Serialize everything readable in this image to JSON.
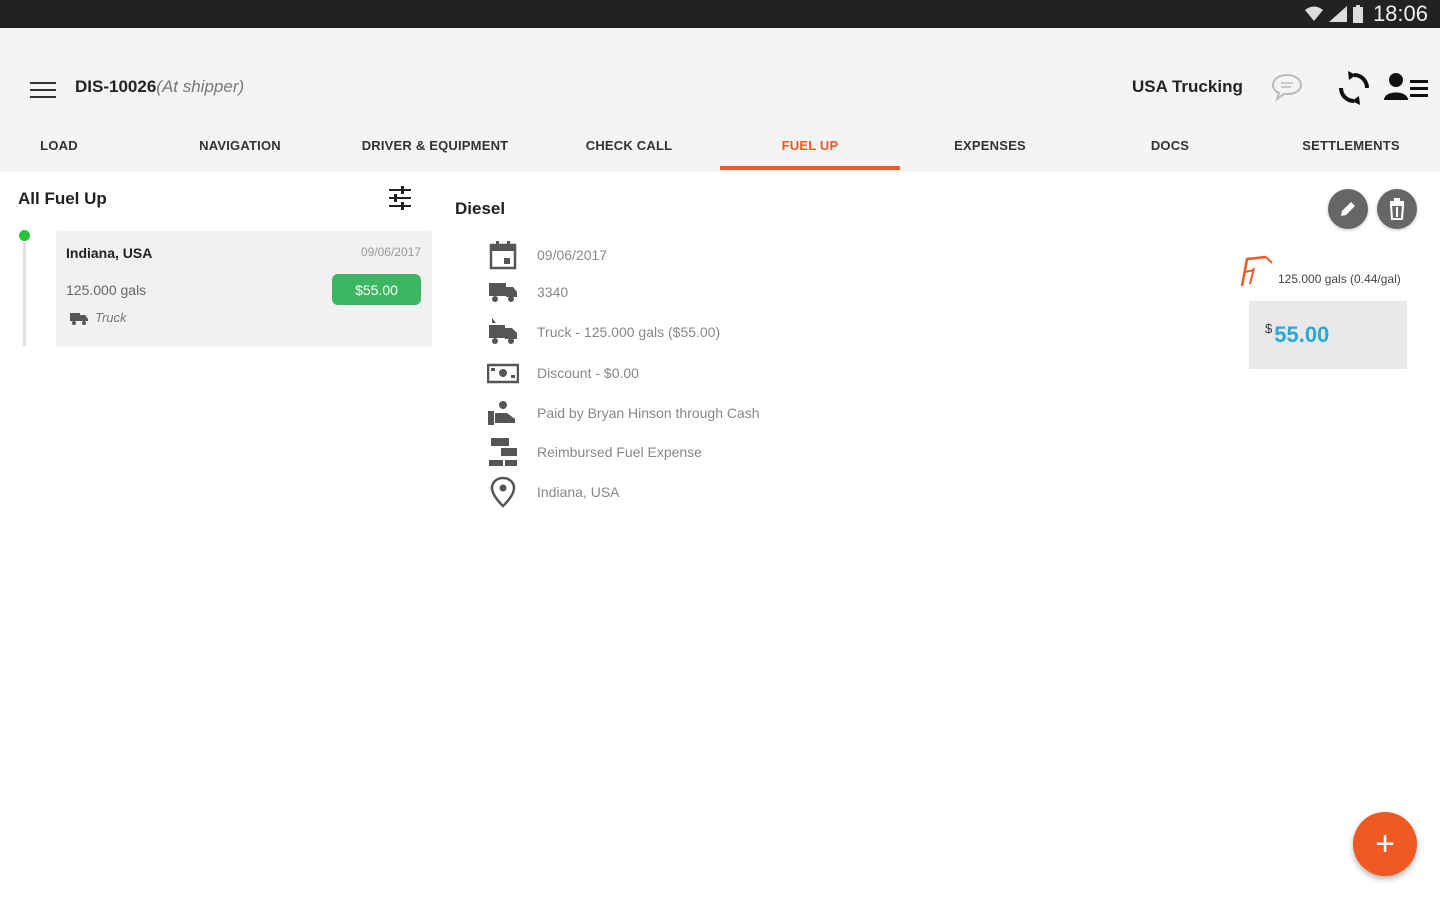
{
  "status_bar": {
    "time": "18:06"
  },
  "header": {
    "load_id": "DIS-10026",
    "load_status": "(At shipper)",
    "company": "USA Trucking"
  },
  "tabs": [
    {
      "label": "LOAD"
    },
    {
      "label": "NAVIGATION"
    },
    {
      "label": "DRIVER & EQUIPMENT"
    },
    {
      "label": "CHECK CALL"
    },
    {
      "label": "FUEL UP",
      "active": true
    },
    {
      "label": "EXPENSES"
    },
    {
      "label": "DOCS"
    },
    {
      "label": "SETTLEMENTS"
    }
  ],
  "list": {
    "title": "All Fuel Up",
    "items": [
      {
        "location": "Indiana, USA",
        "date": "09/06/2017",
        "gallons": "125.000 gals",
        "amount": "$55.00",
        "vehicle": "Truck"
      }
    ]
  },
  "detail": {
    "title": "Diesel",
    "rows": [
      {
        "icon": "calendar-icon",
        "text": "09/06/2017"
      },
      {
        "icon": "truck-icon",
        "text": "3340"
      },
      {
        "icon": "fuel-truck-icon",
        "text": "Truck - 125.000 gals ($55.00)"
      },
      {
        "icon": "discount-icon",
        "text": "Discount - $0.00"
      },
      {
        "icon": "payment-icon",
        "text": "Paid by Bryan Hinson through Cash"
      },
      {
        "icon": "reimburse-icon",
        "text": "Reimbursed Fuel Expense"
      },
      {
        "icon": "location-pin-icon",
        "text": "Indiana, USA"
      }
    ],
    "summary": "125.000 gals (0.44/gal)",
    "total_currency": "$",
    "total_amount": "55.00"
  },
  "fab_label": "+",
  "colors": {
    "accent": "#f05a22",
    "status_green": "#29c33a",
    "amount_badge": "#3cb661",
    "total_text": "#2aa8d8"
  }
}
